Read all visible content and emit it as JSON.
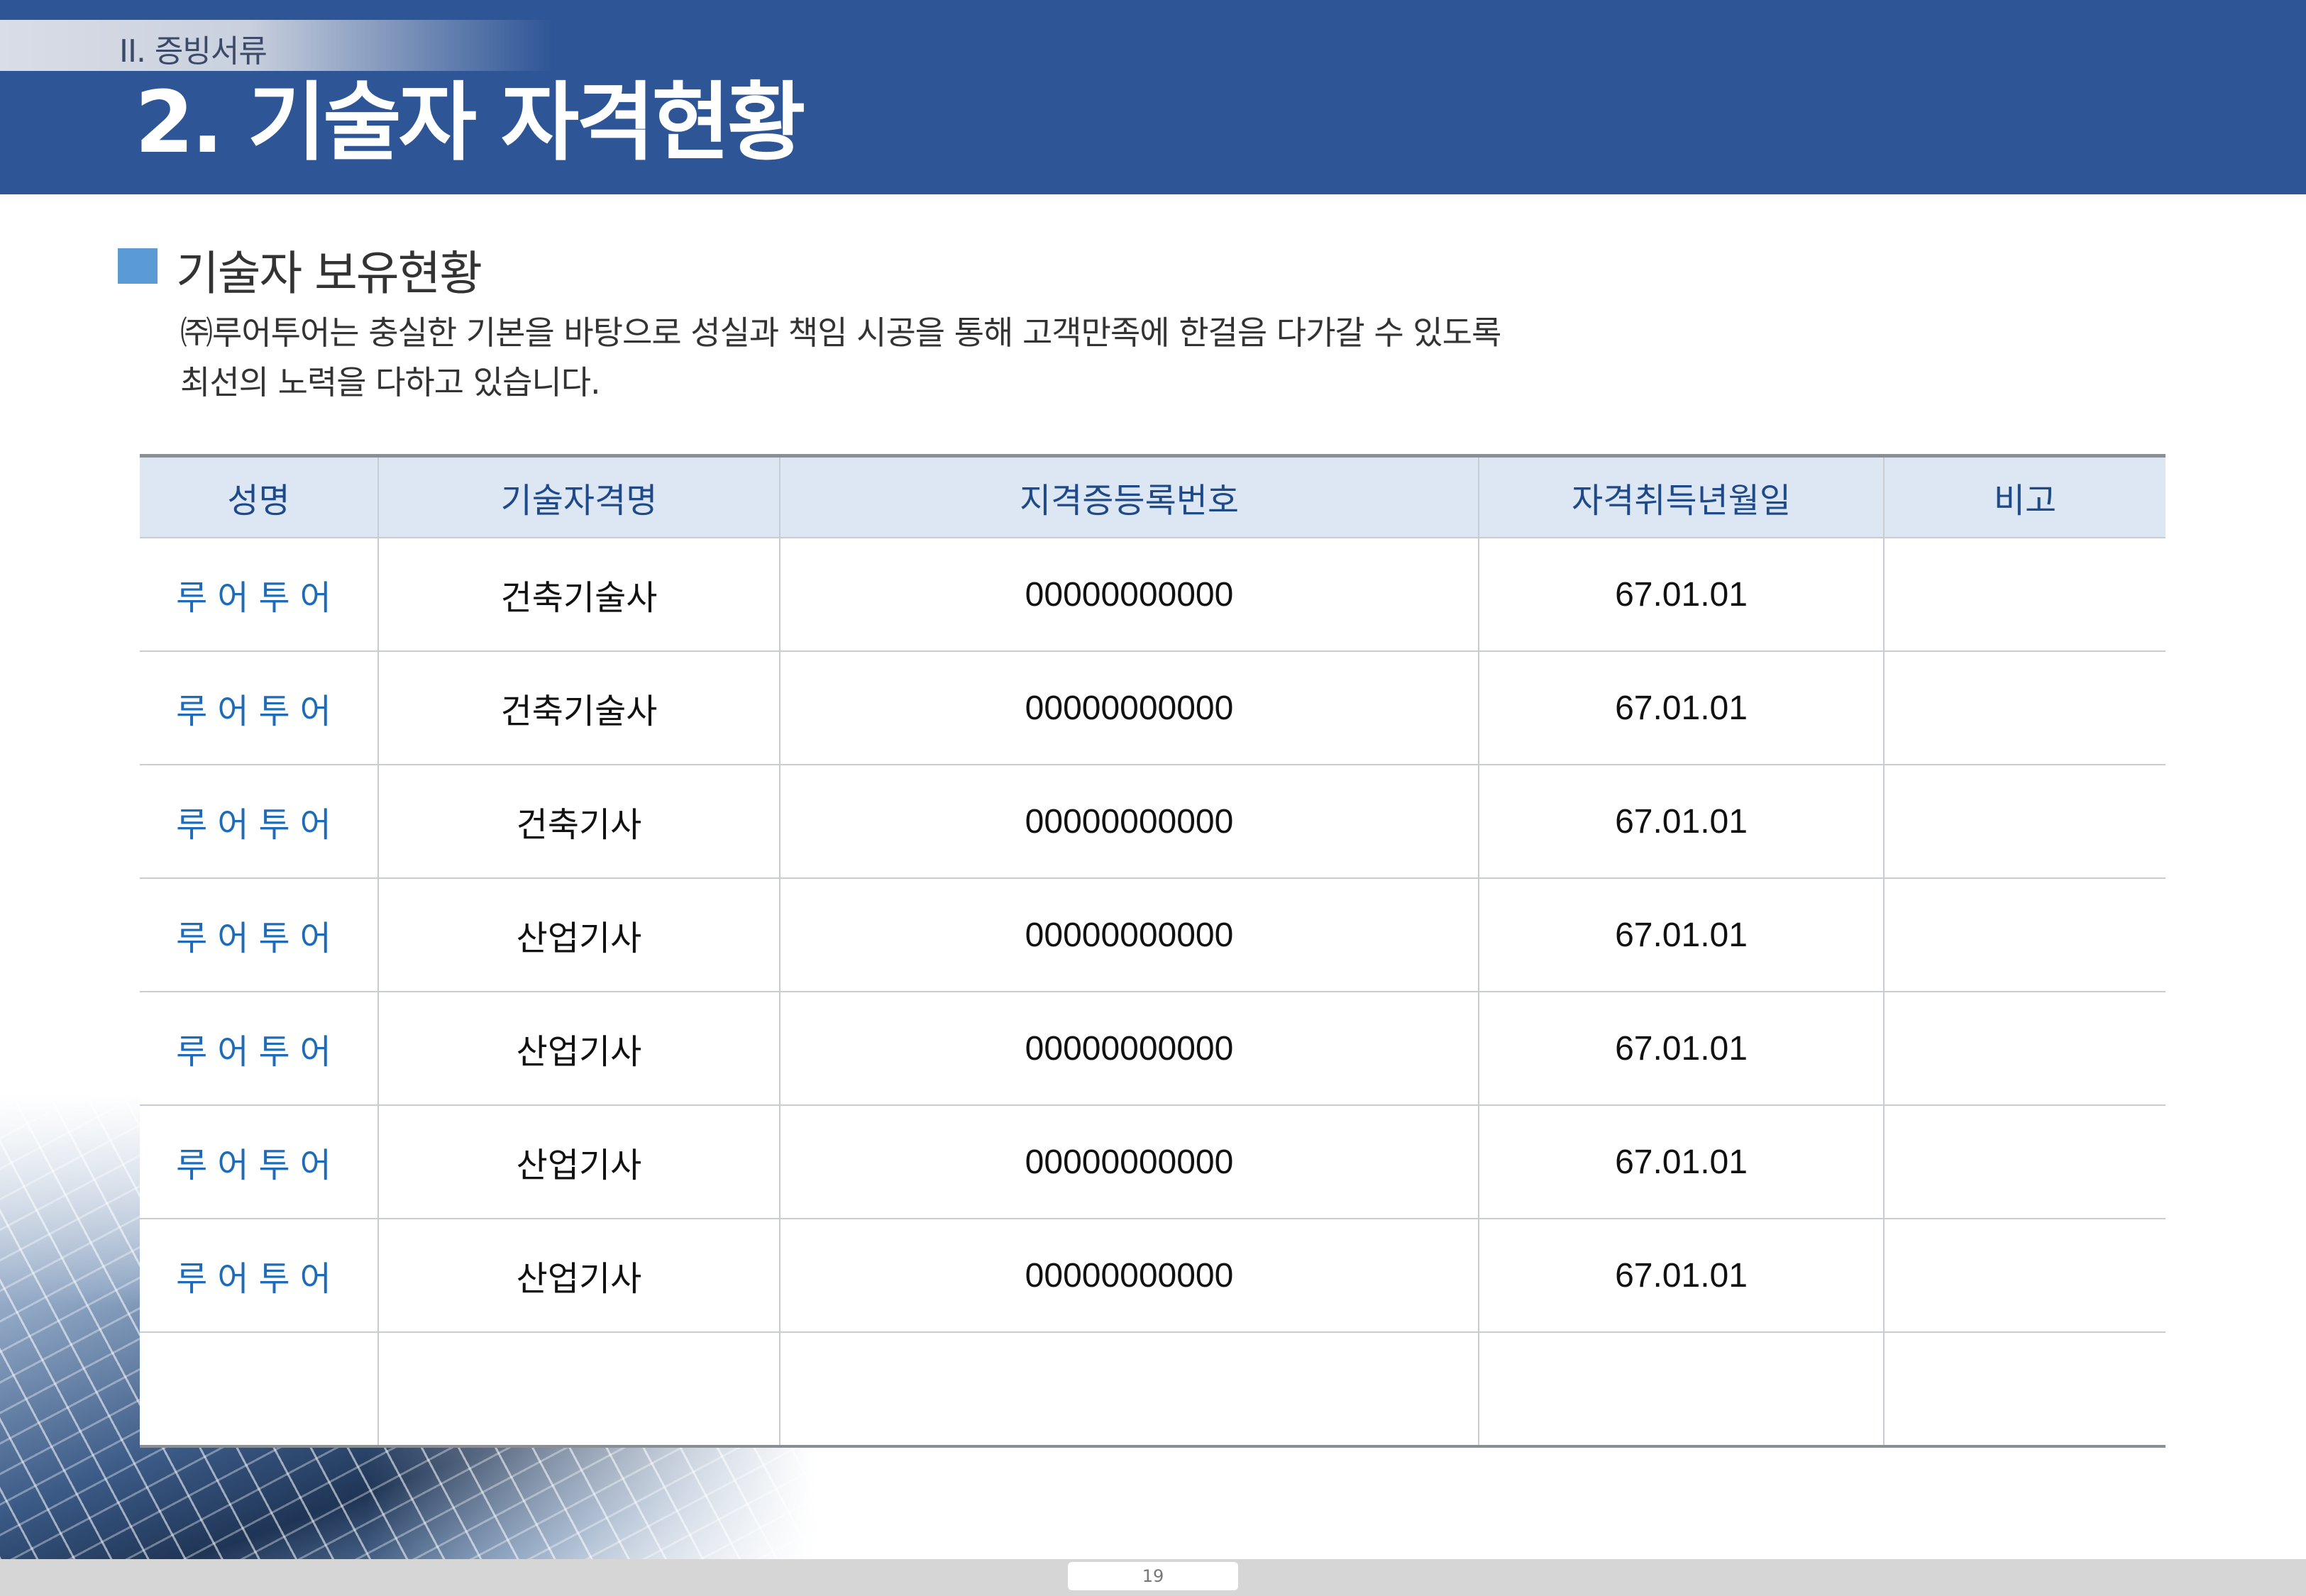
{
  "header": {
    "section_label": "II. 증빙서류",
    "page_title": "2. 기술자 자격현황"
  },
  "subsection": {
    "heading": "기술자 보유현황",
    "intro_line1": "㈜루어투어는 충실한 기본을 바탕으로 성실과 책임 시공을 통해 고객만족에 한걸음 다가갈 수 있도록",
    "intro_line2": "최선의 노력을 다하고 있습니다."
  },
  "table": {
    "headers": [
      "성명",
      "기술자격명",
      "지격증등록번호",
      "자격취득년월일",
      "비고"
    ],
    "rows": [
      {
        "name": "루어투어",
        "qualification": "건축기술사",
        "reg_no": "00000000000",
        "date": "67.01.01",
        "note": ""
      },
      {
        "name": "루어투어",
        "qualification": "건축기술사",
        "reg_no": "00000000000",
        "date": "67.01.01",
        "note": ""
      },
      {
        "name": "루어투어",
        "qualification": "건축기사",
        "reg_no": "00000000000",
        "date": "67.01.01",
        "note": ""
      },
      {
        "name": "루어투어",
        "qualification": "산업기사",
        "reg_no": "00000000000",
        "date": "67.01.01",
        "note": ""
      },
      {
        "name": "루어투어",
        "qualification": "산업기사",
        "reg_no": "00000000000",
        "date": "67.01.01",
        "note": ""
      },
      {
        "name": "루어투어",
        "qualification": "산업기사",
        "reg_no": "00000000000",
        "date": "67.01.01",
        "note": ""
      },
      {
        "name": "루어투어",
        "qualification": "산업기사",
        "reg_no": "00000000000",
        "date": "67.01.01",
        "note": ""
      },
      {
        "name": "",
        "qualification": "",
        "reg_no": "",
        "date": "",
        "note": ""
      }
    ]
  },
  "footer": {
    "page_number": "19"
  },
  "colors": {
    "header_blue": "#2e5596",
    "accent_square": "#5b9bd5",
    "table_header_bg": "#dde7f4",
    "name_text": "#1f6bb8"
  }
}
